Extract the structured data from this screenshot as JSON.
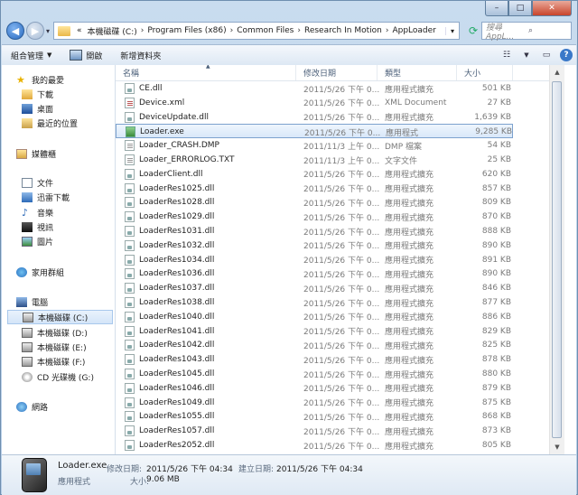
{
  "window": {
    "minimize": "–",
    "maximize": "□",
    "close": "✕"
  },
  "address": {
    "prefix": "«",
    "crumbs": [
      "本機磁碟 (C:)",
      "Program Files (x86)",
      "Common Files",
      "Research In Motion",
      "AppLoader"
    ],
    "search_placeholder": "搜尋 AppL..."
  },
  "toolbar": {
    "organize": "組合管理",
    "open": "開啟",
    "new_folder": "新增資料夾"
  },
  "nav": {
    "favorites": "我的最愛",
    "favorites_items": [
      "下載",
      "桌面",
      "最近的位置"
    ],
    "libraries": "媒體櫃",
    "libraries_items": [
      "文件",
      "迅雷下載",
      "音樂",
      "視訊",
      "圖片"
    ],
    "homegroup": "家用群組",
    "computer": "電腦",
    "computer_items": [
      "本機磁碟 (C:)",
      "本機磁碟 (D:)",
      "本機磁碟 (E:)",
      "本機磁碟 (F:)",
      "CD 光碟機 (G:)"
    ],
    "network": "網路"
  },
  "columns": {
    "name": "名稱",
    "date": "修改日期",
    "type": "類型",
    "size": "大小"
  },
  "files": [
    {
      "name": "CE.dll",
      "date": "2011/5/26 下午 0...",
      "type": "應用程式擴充",
      "size": "501 KB",
      "icon": "dll"
    },
    {
      "name": "Device.xml",
      "date": "2011/5/26 下午 0...",
      "type": "XML Document",
      "size": "27 KB",
      "icon": "xml"
    },
    {
      "name": "DeviceUpdate.dll",
      "date": "2011/5/26 下午 0...",
      "type": "應用程式擴充",
      "size": "1,639 KB",
      "icon": "dll"
    },
    {
      "name": "Loader.exe",
      "date": "2011/5/26 下午 0...",
      "type": "應用程式",
      "size": "9,285 KB",
      "icon": "exe",
      "selected": true
    },
    {
      "name": "Loader_CRASH.DMP",
      "date": "2011/11/3 上午 0...",
      "type": "DMP 檔案",
      "size": "54 KB",
      "icon": "txt"
    },
    {
      "name": "Loader_ERRORLOG.TXT",
      "date": "2011/11/3 上午 0...",
      "type": "文字文件",
      "size": "25 KB",
      "icon": "txt"
    },
    {
      "name": "LoaderClient.dll",
      "date": "2011/5/26 下午 0...",
      "type": "應用程式擴充",
      "size": "620 KB",
      "icon": "dll"
    },
    {
      "name": "LoaderRes1025.dll",
      "date": "2011/5/26 下午 0...",
      "type": "應用程式擴充",
      "size": "857 KB",
      "icon": "dll"
    },
    {
      "name": "LoaderRes1028.dll",
      "date": "2011/5/26 下午 0...",
      "type": "應用程式擴充",
      "size": "809 KB",
      "icon": "dll"
    },
    {
      "name": "LoaderRes1029.dll",
      "date": "2011/5/26 下午 0...",
      "type": "應用程式擴充",
      "size": "870 KB",
      "icon": "dll"
    },
    {
      "name": "LoaderRes1031.dll",
      "date": "2011/5/26 下午 0...",
      "type": "應用程式擴充",
      "size": "888 KB",
      "icon": "dll"
    },
    {
      "name": "LoaderRes1032.dll",
      "date": "2011/5/26 下午 0...",
      "type": "應用程式擴充",
      "size": "890 KB",
      "icon": "dll"
    },
    {
      "name": "LoaderRes1034.dll",
      "date": "2011/5/26 下午 0...",
      "type": "應用程式擴充",
      "size": "891 KB",
      "icon": "dll"
    },
    {
      "name": "LoaderRes1036.dll",
      "date": "2011/5/26 下午 0...",
      "type": "應用程式擴充",
      "size": "890 KB",
      "icon": "dll"
    },
    {
      "name": "LoaderRes1037.dll",
      "date": "2011/5/26 下午 0...",
      "type": "應用程式擴充",
      "size": "846 KB",
      "icon": "dll"
    },
    {
      "name": "LoaderRes1038.dll",
      "date": "2011/5/26 下午 0...",
      "type": "應用程式擴充",
      "size": "877 KB",
      "icon": "dll"
    },
    {
      "name": "LoaderRes1040.dll",
      "date": "2011/5/26 下午 0...",
      "type": "應用程式擴充",
      "size": "886 KB",
      "icon": "dll"
    },
    {
      "name": "LoaderRes1041.dll",
      "date": "2011/5/26 下午 0...",
      "type": "應用程式擴充",
      "size": "829 KB",
      "icon": "dll"
    },
    {
      "name": "LoaderRes1042.dll",
      "date": "2011/5/26 下午 0...",
      "type": "應用程式擴充",
      "size": "825 KB",
      "icon": "dll"
    },
    {
      "name": "LoaderRes1043.dll",
      "date": "2011/5/26 下午 0...",
      "type": "應用程式擴充",
      "size": "878 KB",
      "icon": "dll"
    },
    {
      "name": "LoaderRes1045.dll",
      "date": "2011/5/26 下午 0...",
      "type": "應用程式擴充",
      "size": "880 KB",
      "icon": "dll"
    },
    {
      "name": "LoaderRes1046.dll",
      "date": "2011/5/26 下午 0...",
      "type": "應用程式擴充",
      "size": "879 KB",
      "icon": "dll"
    },
    {
      "name": "LoaderRes1049.dll",
      "date": "2011/5/26 下午 0...",
      "type": "應用程式擴充",
      "size": "875 KB",
      "icon": "dll"
    },
    {
      "name": "LoaderRes1055.dll",
      "date": "2011/5/26 下午 0...",
      "type": "應用程式擴充",
      "size": "868 KB",
      "icon": "dll"
    },
    {
      "name": "LoaderRes1057.dll",
      "date": "2011/5/26 下午 0...",
      "type": "應用程式擴充",
      "size": "873 KB",
      "icon": "dll"
    },
    {
      "name": "LoaderRes2052.dll",
      "date": "2011/5/26 下午 0...",
      "type": "應用程式擴充",
      "size": "805 KB",
      "icon": "dll"
    }
  ],
  "details": {
    "filename": "Loader.exe",
    "modified_label": "修改日期:",
    "modified": "2011/5/26 下午 04:34",
    "created_label": "建立日期:",
    "created": "2011/5/26 下午 04:34",
    "type": "應用程式",
    "size_label": "大小:",
    "size": "9.06 MB"
  },
  "colors": {
    "accent": "#3a78c8",
    "selection_border": "#7da2ce",
    "selection_fill": "#d9e8f9"
  }
}
